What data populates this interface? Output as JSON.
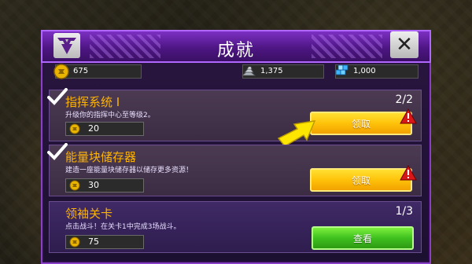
{
  "window": {
    "title": "成就"
  },
  "icons": {
    "logo": "decepticon-logo-icon",
    "close": "close-icon",
    "energon": "energon-coin-icon",
    "alloy": "alloy-ingots-icon",
    "crystal": "blue-crystal-icon",
    "check": "checkmark-icon",
    "alert": "alert-icon",
    "arrow": "pointing-arrow-icon"
  },
  "resources": {
    "energon": "675",
    "alloy": "1,375",
    "crystal": "1,000"
  },
  "achievements": [
    {
      "name": "指挥系统 I",
      "desc": "升级你的指挥中心至等级2。",
      "progress": "2/2",
      "reward": "20",
      "button": "领取",
      "done": true
    },
    {
      "name": "能量块储存器",
      "desc": "建造一座能量块储存器以储存更多资源！",
      "progress": "",
      "reward": "30",
      "button": "领取",
      "done": true
    },
    {
      "name": "领袖关卡",
      "desc": "点击战斗！在关卡1中完成3场战斗。",
      "progress": "1/3",
      "reward": "75",
      "button": "查看",
      "done": false
    }
  ],
  "colors": {
    "accent": "#8a3fc9",
    "gold": "#ffb400",
    "claim": "#ffc20a",
    "view": "#3fc01f",
    "alert": "#d81818"
  }
}
